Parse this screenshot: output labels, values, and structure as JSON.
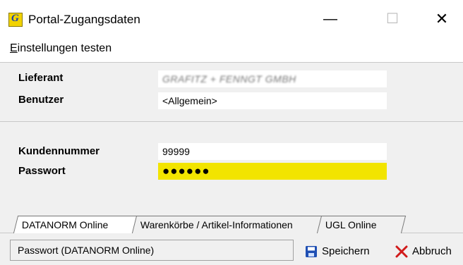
{
  "window": {
    "title": "Portal-Zugangsdaten",
    "icon": "app-logo-icon",
    "minimize": "—",
    "maximize": "☐",
    "close": "✕"
  },
  "menu": {
    "items": [
      {
        "underline": "E",
        "rest": "instellungen testen"
      }
    ]
  },
  "fields": {
    "lieferant_label": "Lieferant",
    "lieferant_value": "GRAFITZ + FENNGT GMBH",
    "benutzer_label": "Benutzer",
    "benutzer_value": "<Allgemein>",
    "kundennummer_label": "Kundennummer",
    "kundennummer_value": "99999",
    "passwort_label": "Passwort",
    "passwort_value": "●●●●●●"
  },
  "tabs": [
    {
      "label": "DATANORM Online",
      "active": true
    },
    {
      "label": "Warenkörbe / Artikel-Informationen",
      "active": false
    },
    {
      "label": "UGL Online",
      "active": false
    }
  ],
  "status": {
    "text": "Passwort (DATANORM Online)"
  },
  "buttons": {
    "save": "Speichern",
    "cancel": "Abbruch"
  },
  "colors": {
    "password_highlight": "#f2e400",
    "save_icon": "#1f4fb3",
    "cancel_icon": "#d11a1a",
    "app_icon_bg": "#f2d300"
  }
}
